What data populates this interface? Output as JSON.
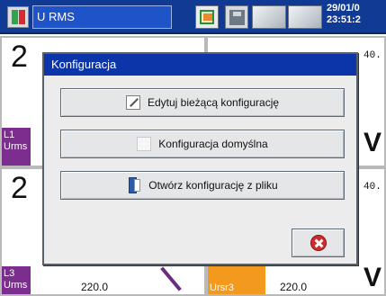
{
  "topbar": {
    "title": "U RMS",
    "clock_date": "29/01/0",
    "clock_time": "23:51:2",
    "icons": [
      "app-logo-icon",
      "sync-icon",
      "disk-icon"
    ]
  },
  "panels": [
    {
      "big_value": "2",
      "tag_line1": "L1",
      "tag_line2": "Urms",
      "tick_value": "40."
    },
    {
      "big_value": "2",
      "tag_line1": "L3",
      "tag_line2": "Urms",
      "tick_value": "40.",
      "value": "220.0"
    },
    {
      "tag_line1": "Ursr3",
      "value": "220.0"
    }
  ],
  "dialog": {
    "title": "Konfiguracja",
    "buttons": [
      {
        "label": "Edytuj bieżącą konfigurację",
        "icon": "edit-pencil-icon"
      },
      {
        "label": "Konfiguracja domyślna",
        "icon": "default-document-icon"
      },
      {
        "label": "Otwórz konfigurację z pliku",
        "icon": "open-file-icon"
      }
    ],
    "close_icon": "close-x-icon"
  },
  "colors": {
    "topbar_bg": "#113a94",
    "dialog_title_bg": "#0b35a8",
    "tag_purple": "#7b2e8e",
    "tag_orange": "#f39a1e",
    "close_red": "#d22b2b"
  }
}
